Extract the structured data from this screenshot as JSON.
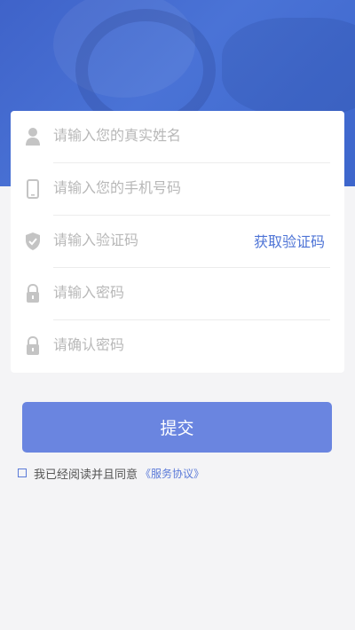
{
  "form": {
    "name_placeholder": "请输入您的真实姓名",
    "phone_placeholder": "请输入您的手机号码",
    "code_placeholder": "请输入验证码",
    "get_code_label": "获取验证码",
    "password_placeholder": "请输入密码",
    "confirm_placeholder": "请确认密码"
  },
  "submit_label": "提交",
  "agreement": {
    "text": "我已经阅读并且同意",
    "link": "《服务协议》",
    "checked": false
  },
  "colors": {
    "header": "#4a73d6",
    "button": "#6a85e0",
    "accent": "#4e74d6",
    "icon": "#c4c4c4"
  }
}
